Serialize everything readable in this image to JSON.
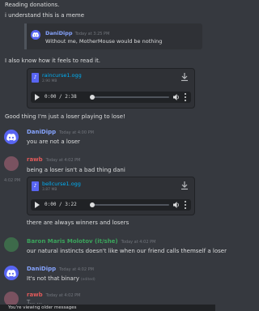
{
  "messages": {
    "m1": "Reading donations.",
    "m2": "i understand this is a meme",
    "m3": "I also know how it feels to read it.",
    "m4": "Good thing I'm just a loser playing to lose!",
    "m5": "you are not a loser",
    "m6": "being a loser isn't a bad thing dani",
    "m7": "there are always winners and losers",
    "m8": "our natural instincts doesn't like when our friend calls themself a loser",
    "m9": "It's not that binary",
    "m9_edited": "(edited)",
    "m10_partial": "T... ..."
  },
  "reply": {
    "username": "DaniDipp",
    "timestamp": "Today at 3:25 PM",
    "text": "Without me, MotherMouse would be nothing"
  },
  "users": {
    "danidipp": "DaniDipp",
    "rawb": "rawb",
    "baron": "Baron Maris Molotov (it/she)"
  },
  "timestamps": {
    "t1": "Today at 4:00 PM",
    "t2": "Today at 4:02 PM",
    "t3": "Today at 4:02 PM",
    "t4": "Today at 4:02 PM",
    "t5": "Today at 4:02 PM",
    "side": "4:02 PM"
  },
  "attachments": {
    "a1": {
      "name": "raincurse1.ogg",
      "size": "2.90 MB",
      "time": "0:00 / 2:38"
    },
    "a2": {
      "name": "bellcurse1.ogg",
      "size": "3.87 MB",
      "time": "0:00 / 3:22"
    }
  },
  "banner": "You're viewing older messages",
  "colors": {
    "background": "#36393f",
    "danidipp": "#86a4ff",
    "rawb": "#e05a5a",
    "baron": "#3ba55c",
    "link": "#00aff4"
  }
}
